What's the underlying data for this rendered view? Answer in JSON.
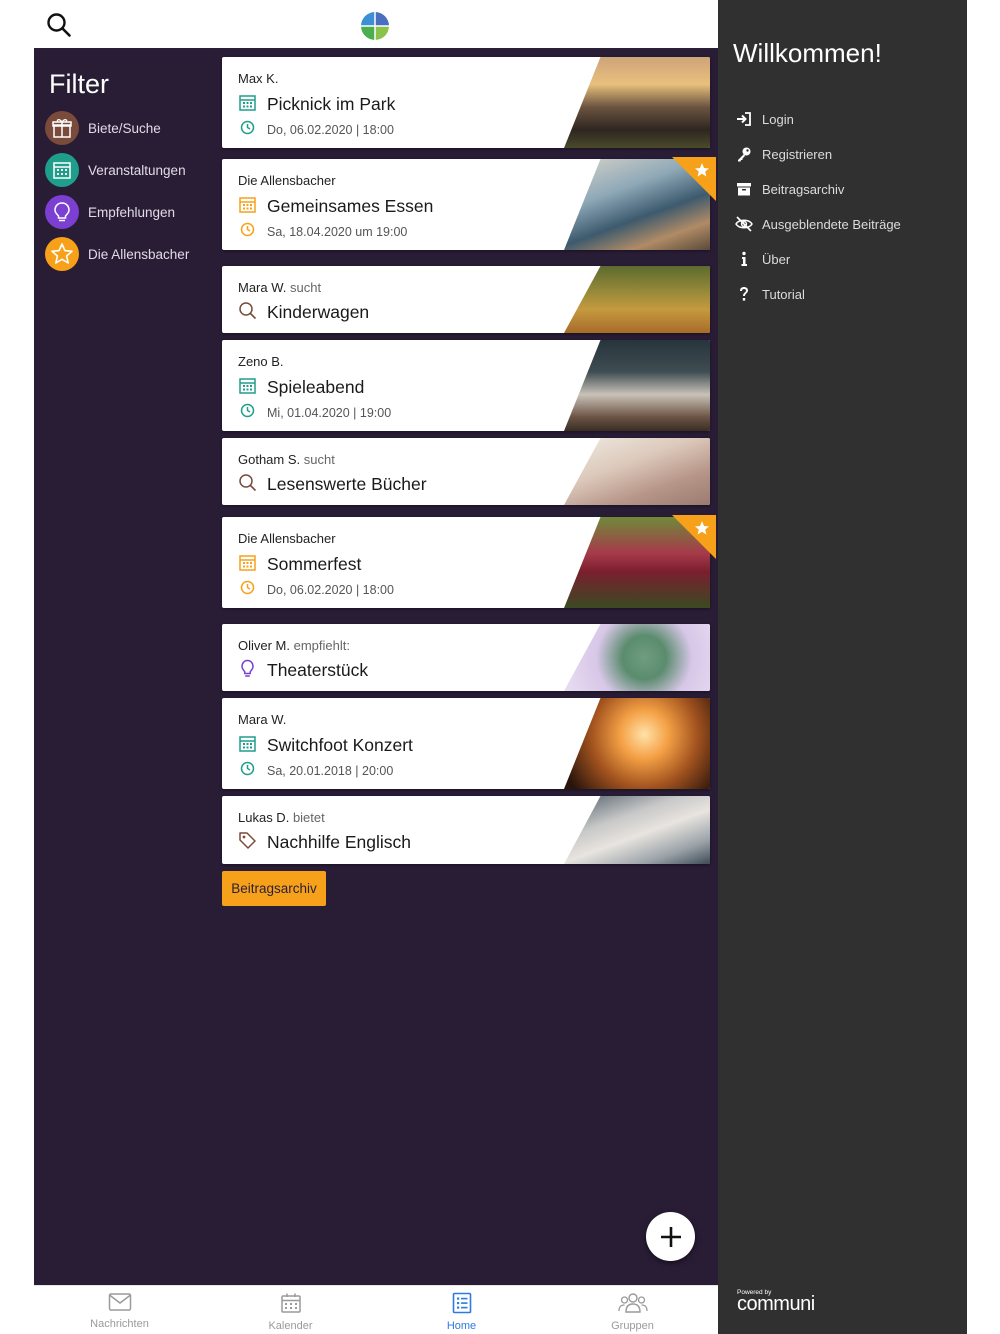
{
  "header": {
    "search_icon": "search-icon",
    "logo": "app-logo"
  },
  "filter": {
    "title": "Filter",
    "items": [
      {
        "label": "Biete/Suche",
        "icon": "gift-icon",
        "color": "#7a4a3a"
      },
      {
        "label": "Veranstaltungen",
        "icon": "calendar-icon",
        "color": "#1f9e8c"
      },
      {
        "label": "Empfehlungen",
        "icon": "lightbulb-icon",
        "color": "#7b3fd1"
      },
      {
        "label": "Die Allensbacher",
        "icon": "star-icon",
        "color": "#f7a11a"
      }
    ]
  },
  "posts": [
    {
      "author": "Max K.",
      "verb": "",
      "title": "Picknick im Park",
      "type_icon": "calendar-icon",
      "date": "Do, 06.02.2020 | 18:00",
      "featured": false,
      "accent": "#1f9e8c"
    },
    {
      "author": "Die Allensbacher",
      "verb": "",
      "title": "Gemeinsames Essen",
      "type_icon": "calendar-icon",
      "date": "Sa, 18.04.2020 um 19:00",
      "featured": true,
      "accent": "#f7a11a"
    },
    {
      "author": "Mara W.",
      "verb": "sucht",
      "title": "Kinderwagen",
      "type_icon": "search-icon",
      "date": "",
      "featured": false,
      "accent": "#7a4a3a"
    },
    {
      "author": "Zeno B.",
      "verb": "",
      "title": "Spieleabend",
      "type_icon": "calendar-icon",
      "date": "Mi, 01.04.2020 | 19:00",
      "featured": false,
      "accent": "#1f9e8c"
    },
    {
      "author": "Gotham S.",
      "verb": "sucht",
      "title": "Lesenswerte Bücher",
      "type_icon": "search-icon",
      "date": "",
      "featured": false,
      "accent": "#7a4a3a"
    },
    {
      "author": "Die Allensbacher",
      "verb": "",
      "title": "Sommerfest",
      "type_icon": "calendar-icon",
      "date": "Do, 06.02.2020 | 18:00",
      "featured": true,
      "accent": "#f7a11a"
    },
    {
      "author": "Oliver M.",
      "verb": "empfiehlt:",
      "title": "Theaterstück",
      "type_icon": "lightbulb-icon",
      "date": "",
      "featured": false,
      "accent": "#7b3fd1"
    },
    {
      "author": "Mara W.",
      "verb": "",
      "title": "Switchfoot Konzert",
      "type_icon": "calendar-icon",
      "date": "Sa, 20.01.2018 | 20:00",
      "featured": false,
      "accent": "#1f9e8c"
    },
    {
      "author": "Lukas D.",
      "verb": "bietet",
      "title": "Nachhilfe Englisch",
      "type_icon": "tag-icon",
      "date": "",
      "featured": false,
      "accent": "#7a4a3a"
    }
  ],
  "archive_button": "Beitragsarchiv",
  "fab_icon": "plus-icon",
  "bottom_nav": [
    {
      "label": "Nachrichten",
      "icon": "mail-icon",
      "active": false
    },
    {
      "label": "Kalender",
      "icon": "calendar-icon",
      "active": false
    },
    {
      "label": "Home",
      "icon": "list-icon",
      "active": true
    },
    {
      "label": "Gruppen",
      "icon": "group-icon",
      "active": false
    }
  ],
  "side_panel": {
    "title": "Willkommen!",
    "items": [
      {
        "label": "Login",
        "icon": "login-icon"
      },
      {
        "label": "Registrieren",
        "icon": "key-icon"
      },
      {
        "label": "Beitragsarchiv",
        "icon": "archive-icon"
      },
      {
        "label": "Ausgeblendete Beiträge",
        "icon": "hidden-eye-icon"
      },
      {
        "label": "Über",
        "icon": "info-icon"
      },
      {
        "label": "Tutorial",
        "icon": "question-icon"
      }
    ],
    "powered_small": "Powered by",
    "powered_brand": "communi"
  },
  "colors": {
    "main_bg": "#291d36",
    "side_bg": "#303030",
    "accent_orange": "#f7a11a",
    "active_blue": "#2d7be0"
  }
}
